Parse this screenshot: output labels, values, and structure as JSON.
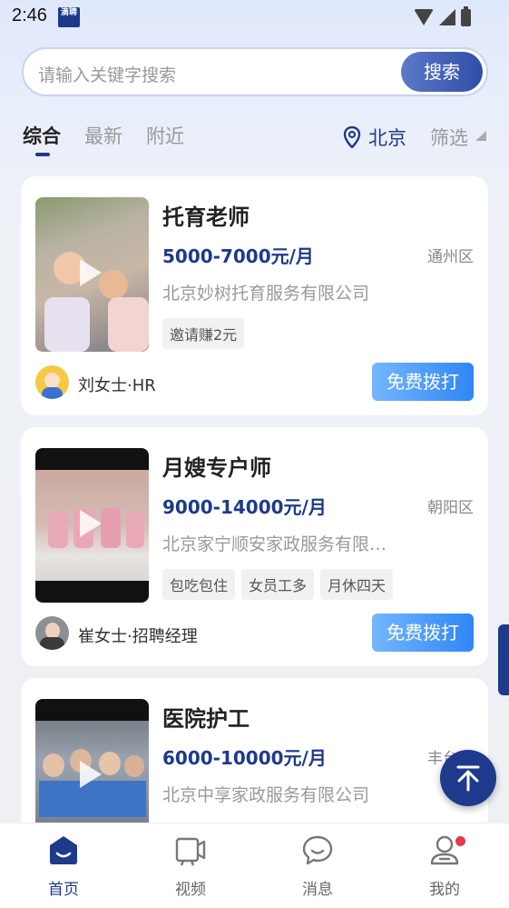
{
  "status_bar": {
    "time": "2:46",
    "app_icon_label": "滴聘"
  },
  "search": {
    "placeholder": "请输入关键字搜索",
    "button_label": "搜索"
  },
  "tabs": [
    {
      "label": "综合",
      "active": true
    },
    {
      "label": "最新",
      "active": false
    },
    {
      "label": "附近",
      "active": false
    }
  ],
  "location": {
    "city": "北京"
  },
  "filter": {
    "label": "筛选"
  },
  "jobs": [
    {
      "title": "托育老师",
      "salary": "5000-7000元/月",
      "district": "通州区",
      "company": "北京妙树托育服务有限公司",
      "tags": [
        "邀请赚2元"
      ],
      "contact": "刘女士·HR",
      "call_label": "免费拨打"
    },
    {
      "title": "月嫂专户师",
      "salary": "9000-14000元/月",
      "district": "朝阳区",
      "company": "北京家宁顺安家政服务有限…",
      "tags": [
        "包吃包住",
        "女员工多",
        "月休四天"
      ],
      "contact": "崔女士·招聘经理",
      "call_label": "免费拨打"
    },
    {
      "title": "医院护工",
      "salary": "6000-10000元/月",
      "district": "丰台区",
      "company": "北京中享家政服务有限公司"
    }
  ],
  "bottom_nav": [
    {
      "label": "首页",
      "icon": "home-icon",
      "active": true
    },
    {
      "label": "视频",
      "icon": "video-icon",
      "active": false
    },
    {
      "label": "消息",
      "icon": "message-icon",
      "active": false
    },
    {
      "label": "我的",
      "icon": "profile-icon",
      "active": false
    }
  ],
  "colors": {
    "brand": "#1d3a8c",
    "call_button": "#2f86f4",
    "badge": "#e53945"
  }
}
